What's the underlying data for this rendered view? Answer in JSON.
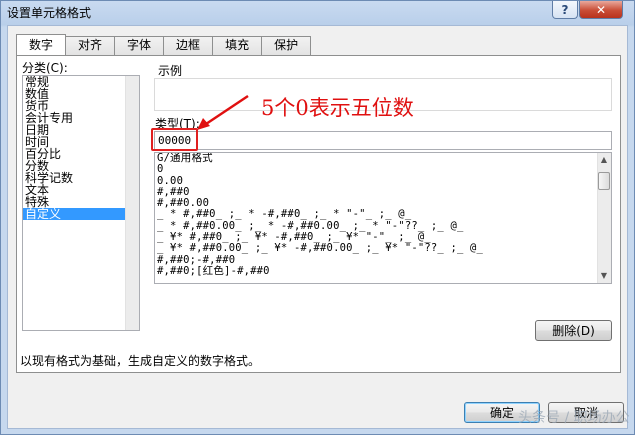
{
  "window": {
    "title": "设置单元格格式",
    "help_label": "?",
    "close_label": "✕"
  },
  "tabs": [
    {
      "label": "数字",
      "active": true
    },
    {
      "label": "对齐"
    },
    {
      "label": "字体"
    },
    {
      "label": "边框"
    },
    {
      "label": "填充"
    },
    {
      "label": "保护"
    }
  ],
  "category": {
    "label": "分类(C):",
    "items": [
      "常规",
      "数值",
      "货币",
      "会计专用",
      "日期",
      "时间",
      "百分比",
      "分数",
      "科学记数",
      "文本",
      "特殊",
      "自定义"
    ],
    "selected": "自定义"
  },
  "sample": {
    "label": "示例"
  },
  "type_field": {
    "label": "类型(T):",
    "value": "00000"
  },
  "annotation": "5个0表示五位数",
  "formats": [
    "G/通用格式",
    "0",
    "0.00",
    "#,##0",
    "#,##0.00",
    "_ * #,##0_ ;_ * -#,##0_ ;_ * \"-\"_ ;_ @_",
    "_ * #,##0.00_ ;_ * -#,##0.00_ ;_ * \"-\"??_ ;_ @_",
    "_ ¥* #,##0_ ;_ ¥* -#,##0_ ;_ ¥* \"-\"_ ;_ @_",
    "_ ¥* #,##0.00_ ;_ ¥* -#,##0.00_ ;_ ¥* \"-\"??_ ;_ @_",
    "#,##0;-#,##0",
    "#,##0;[红色]-#,##0"
  ],
  "delete_button": "删除(D)",
  "description": "以现有格式为基础，生成自定义的数字格式。",
  "ok_button": "确定",
  "cancel_button": "取消",
  "watermark": "头条号 / 职场办公"
}
